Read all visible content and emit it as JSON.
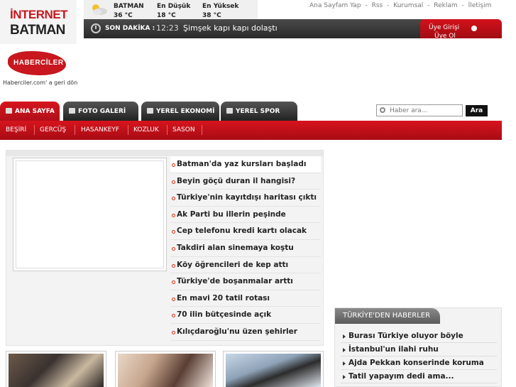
{
  "logo": {
    "line1": "İNTERNET",
    "line2": "BATMAN"
  },
  "weather": {
    "icon": "partly-cloudy-icon",
    "city": "BATMAN",
    "city_temp": "36 °C",
    "low_label": "En Düşük",
    "low_temp": "18 °C",
    "high_label": "En Yüksek",
    "high_temp": "38 °C"
  },
  "topnav": [
    "Ana Sayfam Yap",
    "Rss",
    "Kurumsal",
    "Reklam",
    "İletişim"
  ],
  "topnav_sep": "-",
  "breaking": {
    "label": "SON DAKİKA :",
    "time": "12:23",
    "headline": "Şimşek kapı kapı dolaştı"
  },
  "member": {
    "login": "Üye Girişi",
    "register": "Üye Ol"
  },
  "site": {
    "logo_text": "HABERCİLER",
    "back_link": "Haberciler.com' a geri dön"
  },
  "tabs": [
    "ANA SAYFA",
    "FOTO GALERİ",
    "YEREL EKONOMİ",
    "YEREL SPOR"
  ],
  "search": {
    "placeholder": "Haber ara...",
    "button": "Ara"
  },
  "subnav": [
    "BEŞİRİ",
    "GERCÜŞ",
    "HASANKEYF",
    "KOZLUK",
    "SASON"
  ],
  "slider_headlines": [
    "Batman'da yaz kursları başladı",
    "Beyin göçü duran il hangisi?",
    "Türkiye'nin kayıtdışı haritası çıktı",
    "Ak Parti bu illerin peşinde",
    "Cep telefonu kredi kartı olacak",
    "Takdiri alan sinemaya koştu",
    "Köy öğrencileri de kep attı",
    "Türkiye'de boşanmalar arttı",
    "En mavi 20 tatil rotası",
    "70 ilin bütçesinde açık",
    "Kılıçdaroğlu'nu üzen şehirler"
  ],
  "turkey_news": {
    "title": "TÜRKİYE'DEN HABERLER",
    "items": [
      "Burası Türkiye oluyor böyle",
      "İstanbul'un ilahi ruhu",
      "Ajda Pekkan konserinde koruma",
      "Tatil yapayım dedi ama..."
    ]
  },
  "colors": {
    "brand_red": "#c8171e",
    "dark": "#2a2a2a"
  }
}
